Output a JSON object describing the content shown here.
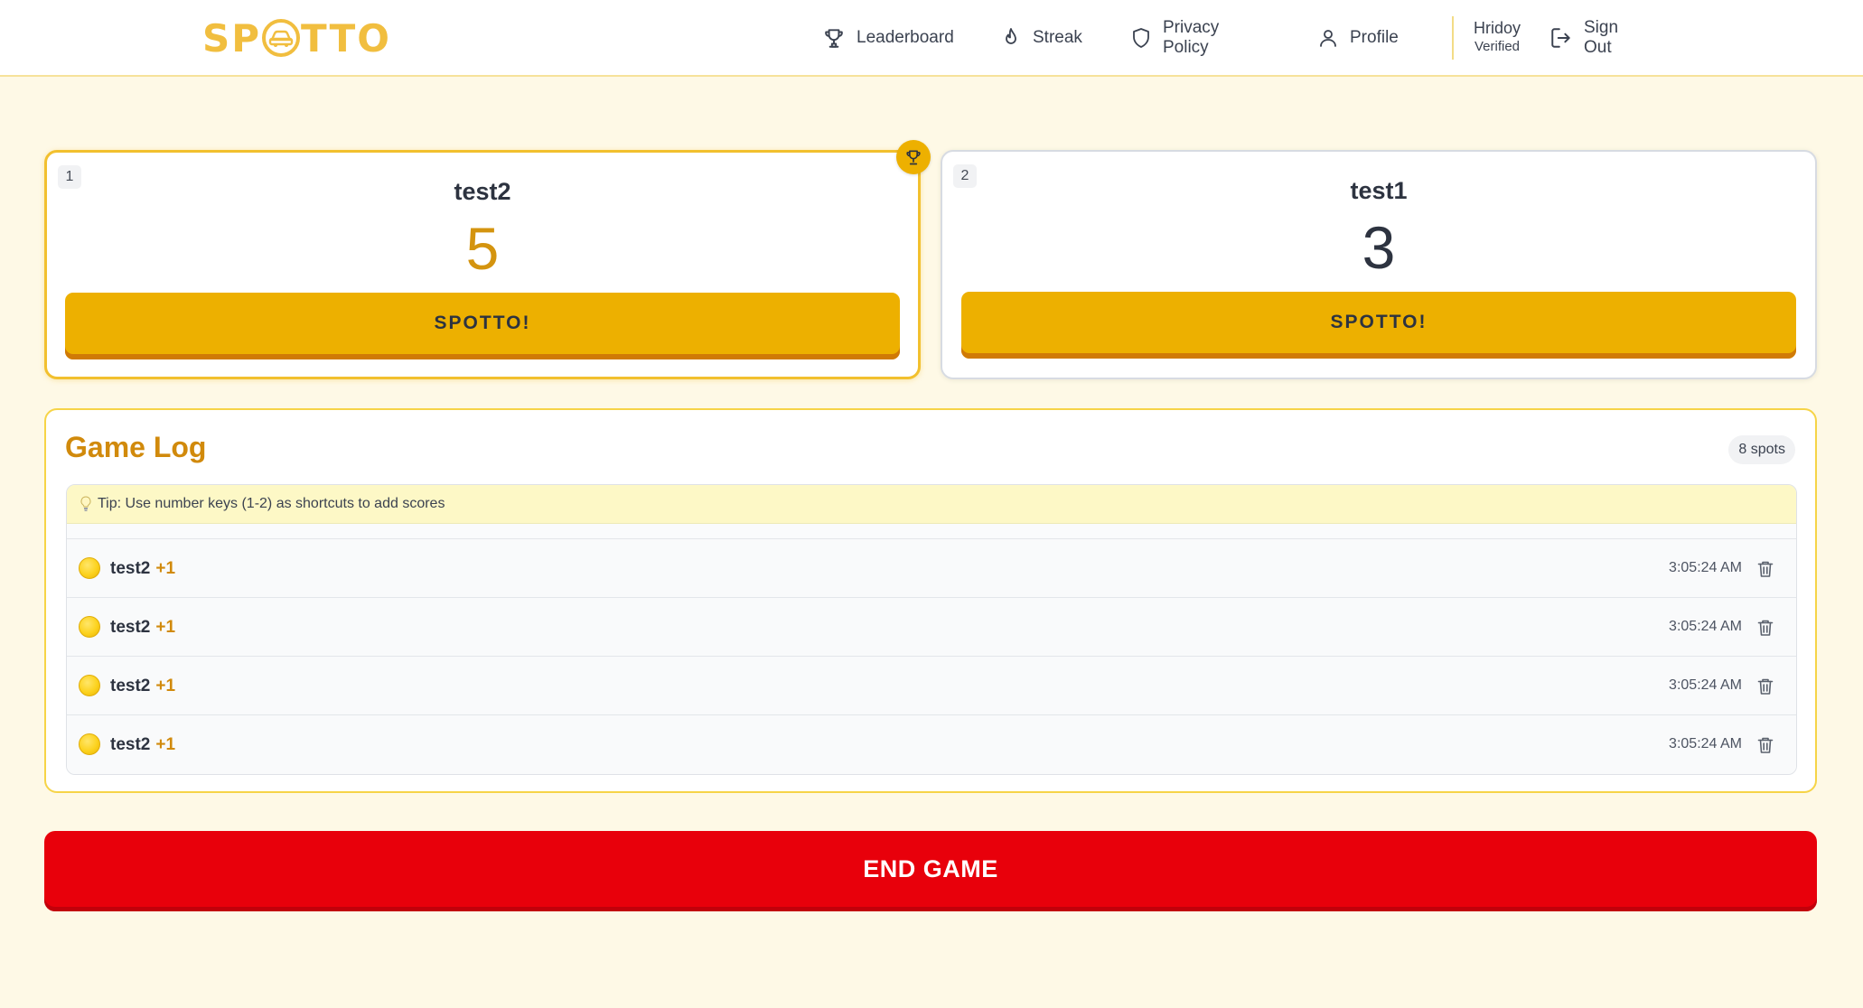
{
  "app": {
    "logo_left": "SP",
    "logo_right": "TTO"
  },
  "nav": {
    "items": [
      {
        "label": "Leaderboard",
        "icon": "trophy-icon"
      },
      {
        "label": "Streak",
        "icon": "flame-icon"
      },
      {
        "label": "Privacy Policy",
        "icon": "shield-icon"
      },
      {
        "label": "Profile",
        "icon": "user-icon"
      }
    ],
    "user": {
      "name": "Hridoy",
      "status": "Verified"
    },
    "sign_out": {
      "label": "Sign Out",
      "icon": "sign-out-icon"
    }
  },
  "players": [
    {
      "index": "1",
      "name": "test2",
      "score": "5",
      "button": "SPOTTO!",
      "leader": true
    },
    {
      "index": "2",
      "name": "test1",
      "score": "3",
      "button": "SPOTTO!",
      "leader": false
    }
  ],
  "game_log": {
    "title": "Game Log",
    "count_badge": "8 spots",
    "tip": "Tip: Use number keys (1-2) as shortcuts to add scores",
    "entries": [
      {
        "player": "test2",
        "points": "+1",
        "time": "3:05:24 AM"
      },
      {
        "player": "test2",
        "points": "+1",
        "time": "3:05:24 AM"
      },
      {
        "player": "test2",
        "points": "+1",
        "time": "3:05:24 AM"
      },
      {
        "player": "test2",
        "points": "+1",
        "time": "3:05:24 AM"
      }
    ]
  },
  "end_game": {
    "label": "END GAME"
  },
  "colors": {
    "brand_yellow": "#edb000",
    "button_shadow": "#d07a06",
    "accent_orange": "#d18a0c",
    "end_red": "#e8000b",
    "page_bg": "#fef9e6"
  }
}
